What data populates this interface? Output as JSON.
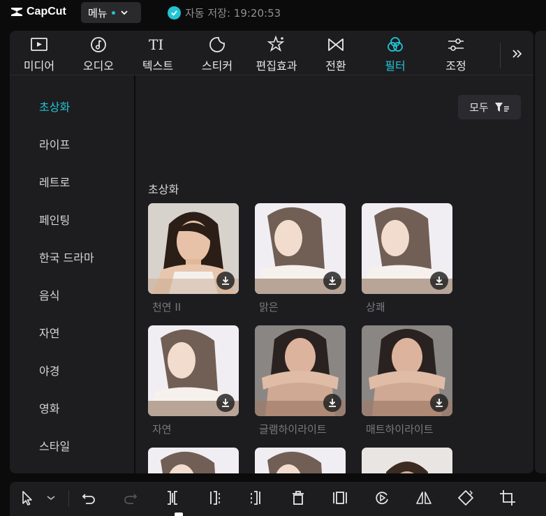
{
  "app": {
    "logo_text": "CapCut"
  },
  "topbar": {
    "menu_label": "메뉴",
    "autosave_text": "자동 저장: 19:20:53"
  },
  "colors": {
    "accent": "#22c4d4",
    "panel": "#1d1d20",
    "background": "#0b0b0c"
  },
  "tabs": [
    {
      "label": "미디어",
      "icon": "media-icon"
    },
    {
      "label": "오디오",
      "icon": "audio-icon"
    },
    {
      "label": "텍스트",
      "icon": "text-icon"
    },
    {
      "label": "스티커",
      "icon": "sticker-icon"
    },
    {
      "label": "편집효과",
      "icon": "effects-icon"
    },
    {
      "label": "전환",
      "icon": "transition-icon"
    },
    {
      "label": "필터",
      "icon": "filter-icon",
      "active": true
    },
    {
      "label": "조정",
      "icon": "adjust-icon"
    }
  ],
  "sidebar": {
    "items": [
      {
        "label": "초상화",
        "active": true
      },
      {
        "label": "라이프"
      },
      {
        "label": "레트로"
      },
      {
        "label": "페인팅"
      },
      {
        "label": "한국 드라마"
      },
      {
        "label": "음식"
      },
      {
        "label": "자연"
      },
      {
        "label": "야경"
      },
      {
        "label": "영화"
      },
      {
        "label": "스타일"
      }
    ]
  },
  "content": {
    "filter_button_label": "모두",
    "section_title": "초상화",
    "cards": [
      {
        "label": "천연 II",
        "style": "natural"
      },
      {
        "label": "맑은",
        "style": "clear"
      },
      {
        "label": "상쾌",
        "style": "clear"
      },
      {
        "label": "자연",
        "style": "clear"
      },
      {
        "label": "글램하이라이트",
        "style": "glam"
      },
      {
        "label": "매트하이라이트",
        "style": "glam"
      },
      {
        "label": "",
        "style": "clear"
      },
      {
        "label": "",
        "style": "clear"
      },
      {
        "label": "",
        "style": "man"
      }
    ]
  },
  "toolbar": {
    "tools": [
      "select-tool-icon",
      "select-dropdown-icon",
      "undo-icon",
      "redo-icon",
      "split-icon",
      "split-left-icon",
      "split-right-icon",
      "delete-icon",
      "freeze-icon",
      "play-reverse-icon",
      "mirror-icon",
      "rotate-icon",
      "crop-icon"
    ]
  }
}
